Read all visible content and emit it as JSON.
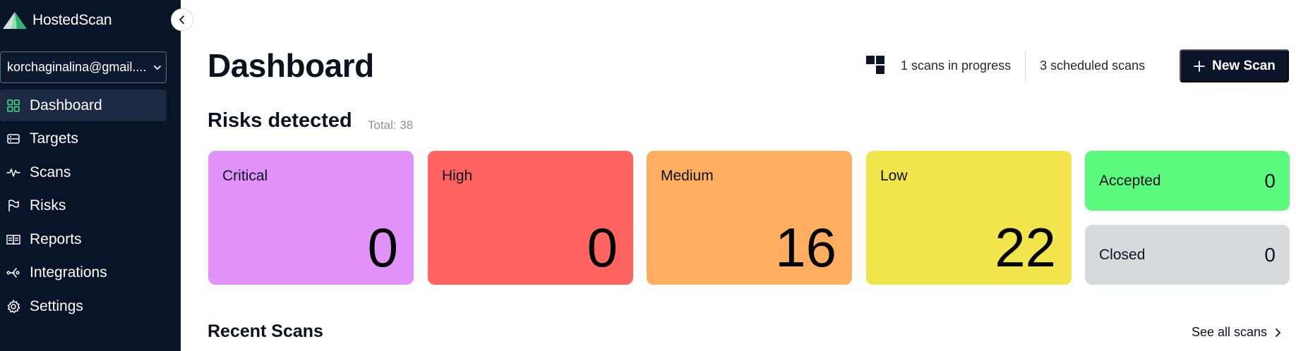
{
  "app": {
    "name": "HostedScan",
    "account": "korchaginalina@gmail...."
  },
  "sidebar": {
    "items": [
      {
        "label": "Dashboard",
        "icon": "dashboard-icon",
        "active": true
      },
      {
        "label": "Targets",
        "icon": "targets-icon"
      },
      {
        "label": "Scans",
        "icon": "scans-icon"
      },
      {
        "label": "Risks",
        "icon": "risks-flag-icon"
      },
      {
        "label": "Reports",
        "icon": "reports-book-icon"
      },
      {
        "label": "Integrations",
        "icon": "integrations-icon"
      },
      {
        "label": "Settings",
        "icon": "gear-icon"
      }
    ]
  },
  "header": {
    "title": "Dashboard",
    "scans_in_progress": "1 scans in progress",
    "scheduled_scans": "3 scheduled scans",
    "new_scan_label": "New Scan"
  },
  "risks": {
    "title": "Risks detected",
    "total": "Total: 38",
    "cards": [
      {
        "label": "Critical",
        "value": "0",
        "color": "#e293fb"
      },
      {
        "label": "High",
        "value": "0",
        "color": "#ff6461"
      },
      {
        "label": "Medium",
        "value": "16",
        "color": "#ffae61"
      },
      {
        "label": "Low",
        "value": "22",
        "color": "#f2e44c"
      }
    ],
    "accepted": {
      "label": "Accepted",
      "value": "0",
      "color": "#5bf97d"
    },
    "closed": {
      "label": "Closed",
      "value": "0",
      "color": "#d7dadd"
    }
  },
  "recent": {
    "title": "Recent Scans",
    "see_all": "See all scans"
  },
  "colors": {
    "sidebar_bg": "#0a1428",
    "active_item_bg": "#1d2942",
    "accent_green": "#4ade80",
    "button_bg": "#0b1428"
  }
}
